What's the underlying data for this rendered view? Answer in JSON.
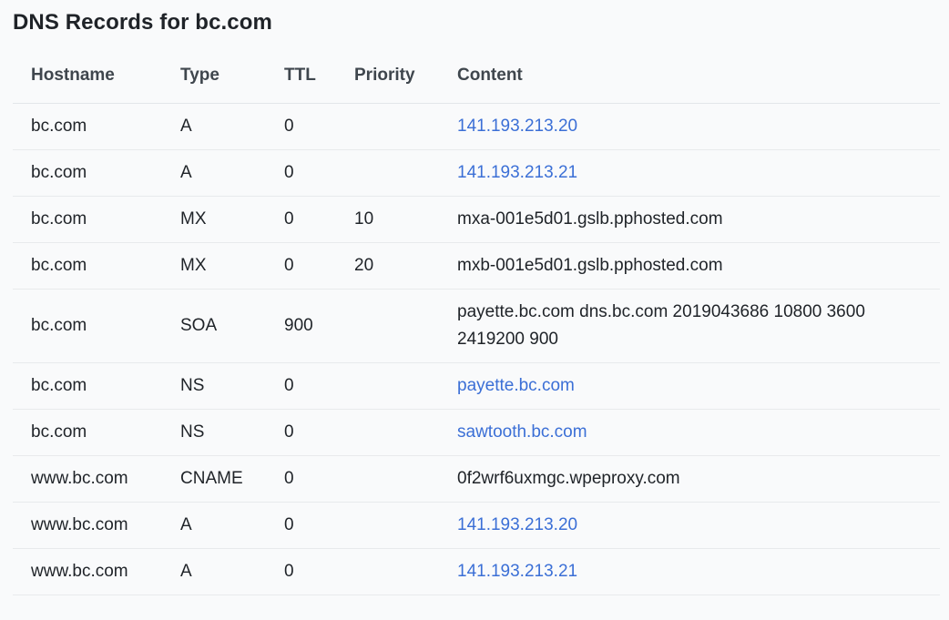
{
  "page": {
    "title": "DNS Records for bc.com"
  },
  "table": {
    "headers": {
      "hostname": "Hostname",
      "type": "Type",
      "ttl": "TTL",
      "priority": "Priority",
      "content": "Content"
    },
    "rows": [
      {
        "hostname": "bc.com",
        "type": "A",
        "ttl": "0",
        "priority": "",
        "content": "141.193.213.20",
        "is_link": true
      },
      {
        "hostname": "bc.com",
        "type": "A",
        "ttl": "0",
        "priority": "",
        "content": "141.193.213.21",
        "is_link": true
      },
      {
        "hostname": "bc.com",
        "type": "MX",
        "ttl": "0",
        "priority": "10",
        "content": "mxa-001e5d01.gslb.pphosted.com",
        "is_link": false
      },
      {
        "hostname": "bc.com",
        "type": "MX",
        "ttl": "0",
        "priority": "20",
        "content": "mxb-001e5d01.gslb.pphosted.com",
        "is_link": false
      },
      {
        "hostname": "bc.com",
        "type": "SOA",
        "ttl": "900",
        "priority": "",
        "content": "payette.bc.com dns.bc.com 2019043686 10800 3600 2419200 900",
        "is_link": false
      },
      {
        "hostname": "bc.com",
        "type": "NS",
        "ttl": "0",
        "priority": "",
        "content": "payette.bc.com",
        "is_link": true
      },
      {
        "hostname": "bc.com",
        "type": "NS",
        "ttl": "0",
        "priority": "",
        "content": "sawtooth.bc.com",
        "is_link": true
      },
      {
        "hostname": "www.bc.com",
        "type": "CNAME",
        "ttl": "0",
        "priority": "",
        "content": "0f2wrf6uxmgc.wpeproxy.com",
        "is_link": false
      },
      {
        "hostname": "www.bc.com",
        "type": "A",
        "ttl": "0",
        "priority": "",
        "content": "141.193.213.20",
        "is_link": true
      },
      {
        "hostname": "www.bc.com",
        "type": "A",
        "ttl": "0",
        "priority": "",
        "content": "141.193.213.21",
        "is_link": true
      }
    ]
  },
  "colors": {
    "link": "#3b6fd6",
    "text": "#1f2328",
    "header_text": "#3f464d",
    "background": "#f9fafb",
    "divider": "#e8eaec"
  }
}
